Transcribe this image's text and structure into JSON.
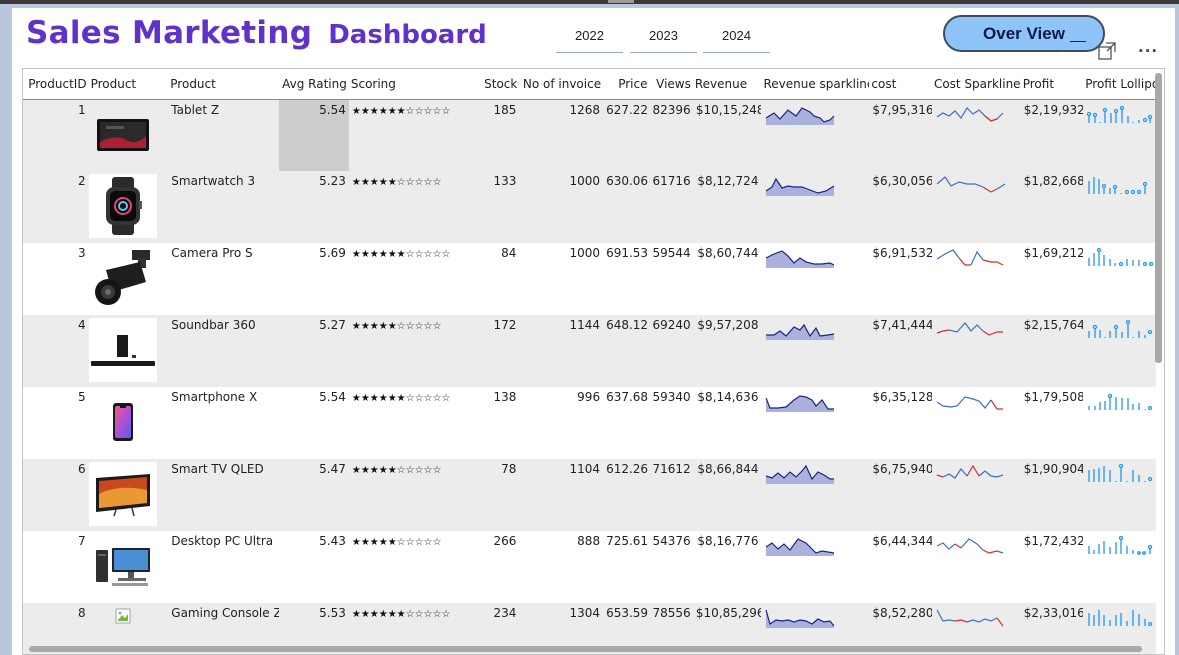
{
  "dashboard": {
    "title_part1": "Sales Marketing",
    "title_part2": "Dashboard",
    "years": [
      "2022",
      "2023",
      "2024"
    ],
    "overview_button": "Over View",
    "more_options": "..."
  },
  "table": {
    "columns": [
      "ProductID",
      "Product",
      "Product",
      "Avg Rating",
      "Scoring",
      "Stock",
      "No of invoice",
      "Price",
      "Views",
      "Revenue",
      "Revenue sparkline",
      "cost",
      "Cost Sparkline",
      "Profit",
      "Profit Lollipo"
    ],
    "rows": [
      {
        "id": "1",
        "product": "Tablet Z",
        "rating": "5.54",
        "stars": "★★★★★★☆☆☆☆☆",
        "stock": "185",
        "invoices": "1268",
        "price": "627.22",
        "views": "82396",
        "revenue": "$10,15,248",
        "cost": "$7,95,316",
        "profit": "$2,19,932"
      },
      {
        "id": "2",
        "product": "Smartwatch 3",
        "rating": "5.23",
        "stars": "★★★★★☆☆☆☆☆",
        "stock": "133",
        "invoices": "1000",
        "price": "630.06",
        "views": "61716",
        "revenue": "$8,12,724",
        "cost": "$6,30,056",
        "profit": "$1,82,668"
      },
      {
        "id": "3",
        "product": "Camera Pro S",
        "rating": "5.69",
        "stars": "★★★★★★☆☆☆☆☆",
        "stock": "84",
        "invoices": "1000",
        "price": "691.53",
        "views": "59544",
        "revenue": "$8,60,744",
        "cost": "$6,91,532",
        "profit": "$1,69,212"
      },
      {
        "id": "4",
        "product": "Soundbar 360",
        "rating": "5.27",
        "stars": "★★★★★☆☆☆☆☆",
        "stock": "172",
        "invoices": "1144",
        "price": "648.12",
        "views": "69240",
        "revenue": "$9,57,208",
        "cost": "$7,41,444",
        "profit": "$2,15,764"
      },
      {
        "id": "5",
        "product": "Smartphone X",
        "rating": "5.54",
        "stars": "★★★★★★☆☆☆☆☆",
        "stock": "138",
        "invoices": "996",
        "price": "637.68",
        "views": "59340",
        "revenue": "$8,14,636",
        "cost": "$6,35,128",
        "profit": "$1,79,508"
      },
      {
        "id": "6",
        "product": "Smart TV QLED",
        "rating": "5.47",
        "stars": "★★★★★☆☆☆☆☆",
        "stock": "78",
        "invoices": "1104",
        "price": "612.26",
        "views": "71612",
        "revenue": "$8,66,844",
        "cost": "$6,75,940",
        "profit": "$1,90,904"
      },
      {
        "id": "7",
        "product": "Desktop PC Ultra",
        "rating": "5.43",
        "stars": "★★★★★☆☆☆☆☆",
        "stock": "266",
        "invoices": "888",
        "price": "725.61",
        "views": "54376",
        "revenue": "$8,16,776",
        "cost": "$6,44,344",
        "profit": "$1,72,432"
      },
      {
        "id": "8",
        "product": "Gaming Console Z",
        "rating": "5.53",
        "stars": "★★★★★★☆☆☆☆☆",
        "stock": "234",
        "invoices": "1304",
        "price": "653.59",
        "views": "78556",
        "revenue": "$10,85,296",
        "cost": "$8,52,280",
        "profit": "$2,33,016"
      }
    ]
  },
  "colors": {
    "title": "#6132c9",
    "overview_button_bg": "#8ec4f8",
    "revenue_line": "#1a237e",
    "revenue_fill": "#aab1dd",
    "cost_line_up": "#3b6fc4",
    "cost_line_down": "#d32f2f",
    "lollipop": "#2196f3"
  }
}
